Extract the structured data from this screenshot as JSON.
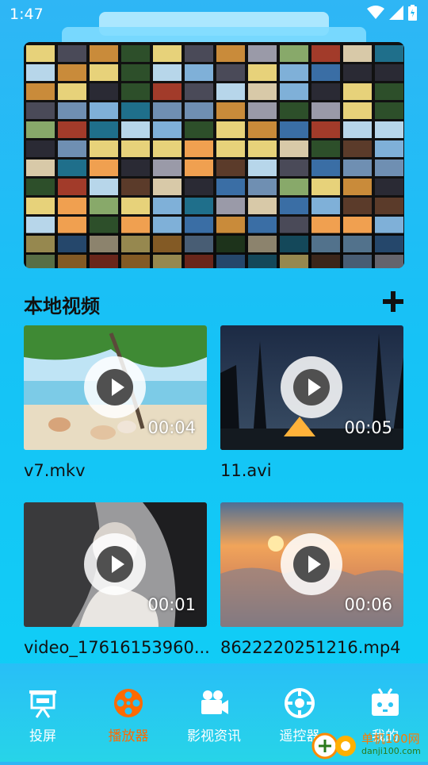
{
  "status_bar": {
    "time": "1:47"
  },
  "section": {
    "title": "本地视频"
  },
  "videos": [
    {
      "name": "v7.mkv",
      "duration": "00:04"
    },
    {
      "name": "11.avi",
      "duration": "00:05"
    },
    {
      "name": "video_17616153960...",
      "duration": "00:01"
    },
    {
      "name": "8622220251216.mp4",
      "duration": "00:06"
    }
  ],
  "nav": {
    "items": [
      {
        "label": "投屏",
        "icon": "projector-screen-icon"
      },
      {
        "label": "播放器",
        "icon": "film-reel-icon",
        "active": true
      },
      {
        "label": "影视资讯",
        "icon": "video-camera-icon"
      },
      {
        "label": "遥控器",
        "icon": "remote-control-icon"
      },
      {
        "label": "我的",
        "icon": "tv-profile-icon"
      }
    ]
  },
  "watermark": {
    "line1": "单机100网",
    "line2": "danji100.com"
  },
  "colors": {
    "accent": "#ff6a00",
    "background": "#16c2f6"
  }
}
